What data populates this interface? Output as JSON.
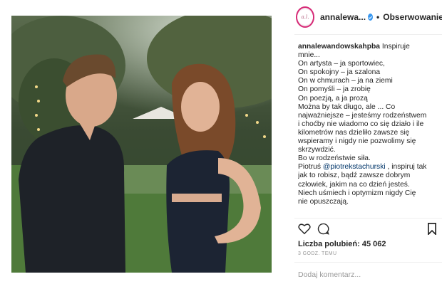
{
  "post": {
    "username": "annalewa...",
    "follow_label": "Obserwowanie",
    "separator": "•",
    "avatar_text": "annalewandowska"
  },
  "caption": {
    "username": "annalewandowskahpba",
    "lines": [
      "Inspiruje",
      "mnie...",
      "On artysta – ja sportowiec,",
      "On spokojny – ja szalona",
      "On w chmurach – ja na ziemi",
      "On pomyśli – ja zrobię",
      "On poezją, a ja prozą",
      "Można by tak długo, ale ... Co",
      "najważniejsze – jesteśmy rodzeństwem",
      "i choćby nie wiadomo co się działo i ile",
      "kilometrów nas dzieliło zawsze się",
      "wspieramy i nigdy nie pozwolimy się",
      "skrzywdzić.",
      "Bo w rodzeństwie siła.",
      "Piotruś ",
      "@piotrekstachurski",
      " , inspiruj tak",
      "jak to robisz, bądź zawsze dobrym",
      "człowiek, jakim na co dzień jesteś.",
      "Niech uśmiech i optymizm nigdy Cię",
      "nie opuszczają."
    ]
  },
  "stats": {
    "likes": "Liczba polubień: 45 062",
    "time": "3 GODZ. TEMU"
  },
  "comment": {
    "placeholder": "Dodaj komentarz..."
  },
  "colors": {
    "verified": "#3897f0",
    "mention": "#003569"
  }
}
